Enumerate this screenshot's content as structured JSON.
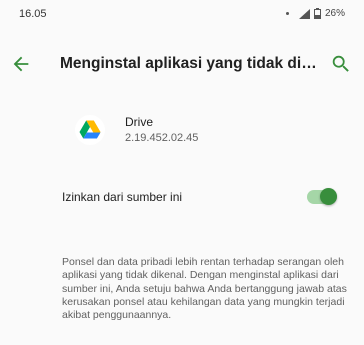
{
  "status_bar": {
    "time": "16.05",
    "battery": "26%"
  },
  "app_bar": {
    "title": "Menginstal aplikasi yang tidak dikenal"
  },
  "app": {
    "name": "Drive",
    "version": "2.19.452.02.45"
  },
  "setting": {
    "label": "Izinkan dari sumber ini",
    "enabled": true
  },
  "warning": {
    "text": "Ponsel dan data pribadi lebih rentan terhadap serangan oleh aplikasi yang tidak dikenal. Dengan menginstal aplikasi dari sumber ini, Anda setuju bahwa Anda bertanggung jawab atas kerusakan ponsel atau kehilangan data yang mungkin terjadi akibat penggunaannya."
  },
  "colors": {
    "accent": "#388e3c",
    "accent_track": "#a5d6a7",
    "drive_yellow": "#ffba00",
    "drive_green": "#00a85f",
    "drive_blue": "#2684fc"
  },
  "icons": {
    "back": "arrow-back-icon",
    "search": "search-icon",
    "app": "google-drive-icon",
    "signal": "signal-icon",
    "battery": "battery-icon"
  }
}
